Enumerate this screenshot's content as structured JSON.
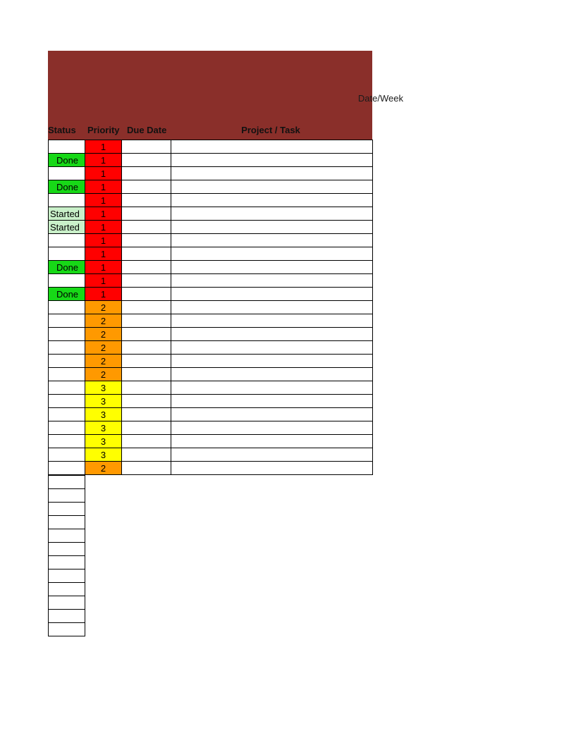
{
  "header": {
    "date_week_label": "Date/Week",
    "columns": {
      "status": "Status",
      "priority": "Priority",
      "due": "Due Date",
      "task": "Project / Task"
    }
  },
  "colors": {
    "header_bg": "#8a2f2a",
    "priority_1": "#ff0000",
    "priority_2": "#ff9900",
    "priority_3": "#ffff00",
    "status_done": "#17d817",
    "status_started": "#c9f0c9"
  },
  "status_labels": {
    "done": "Done",
    "started": "Started"
  },
  "rows": [
    {
      "status": "",
      "priority": 1
    },
    {
      "status": "done",
      "priority": 1
    },
    {
      "status": "",
      "priority": 1
    },
    {
      "status": "done",
      "priority": 1
    },
    {
      "status": "",
      "priority": 1
    },
    {
      "status": "started",
      "priority": 1
    },
    {
      "status": "started",
      "priority": 1
    },
    {
      "status": "",
      "priority": 1
    },
    {
      "status": "",
      "priority": 1
    },
    {
      "status": "done",
      "priority": 1
    },
    {
      "status": "",
      "priority": 1
    },
    {
      "status": "done",
      "priority": 1
    },
    {
      "status": "",
      "priority": 2
    },
    {
      "status": "",
      "priority": 2
    },
    {
      "status": "",
      "priority": 2
    },
    {
      "status": "",
      "priority": 2
    },
    {
      "status": "",
      "priority": 2
    },
    {
      "status": "",
      "priority": 2
    },
    {
      "status": "",
      "priority": 3
    },
    {
      "status": "",
      "priority": 3
    },
    {
      "status": "",
      "priority": 3
    },
    {
      "status": "",
      "priority": 3
    },
    {
      "status": "",
      "priority": 3
    },
    {
      "status": "",
      "priority": 3
    },
    {
      "status": "",
      "priority": 2
    }
  ],
  "tail_empty_rows": 12
}
